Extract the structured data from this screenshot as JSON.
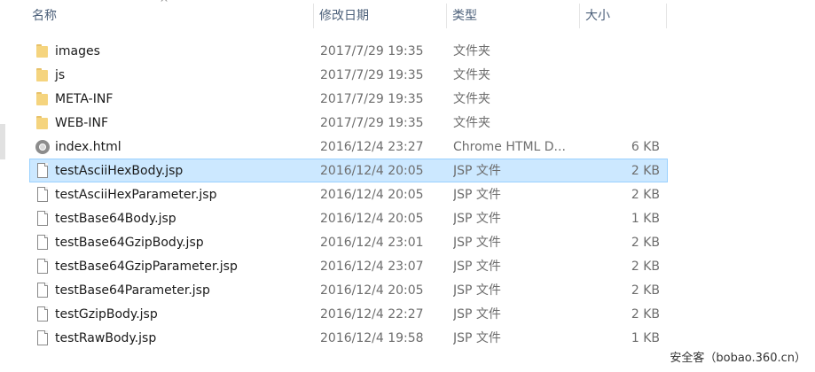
{
  "columns": {
    "name": "名称",
    "date": "修改日期",
    "type": "类型",
    "size": "大小"
  },
  "sort_indicator": "^",
  "files": [
    {
      "name": "images",
      "date": "2017/7/29 19:35",
      "type": "文件夹",
      "size": "",
      "icon": "folder-icon"
    },
    {
      "name": "js",
      "date": "2017/7/29 19:35",
      "type": "文件夹",
      "size": "",
      "icon": "folder-icon"
    },
    {
      "name": "META-INF",
      "date": "2017/7/29 19:35",
      "type": "文件夹",
      "size": "",
      "icon": "folder-icon"
    },
    {
      "name": "WEB-INF",
      "date": "2017/7/29 19:35",
      "type": "文件夹",
      "size": "",
      "icon": "folder-icon"
    },
    {
      "name": "index.html",
      "date": "2016/12/4 23:27",
      "type": "Chrome HTML D...",
      "size": "6 KB",
      "icon": "chrome-icon"
    },
    {
      "name": "testAsciiHexBody.jsp",
      "date": "2016/12/4 20:05",
      "type": "JSP 文件",
      "size": "2 KB",
      "icon": "file-icon",
      "selected": true
    },
    {
      "name": "testAsciiHexParameter.jsp",
      "date": "2016/12/4 20:05",
      "type": "JSP 文件",
      "size": "2 KB",
      "icon": "file-icon"
    },
    {
      "name": "testBase64Body.jsp",
      "date": "2016/12/4 20:05",
      "type": "JSP 文件",
      "size": "1 KB",
      "icon": "file-icon"
    },
    {
      "name": "testBase64GzipBody.jsp",
      "date": "2016/12/4 23:01",
      "type": "JSP 文件",
      "size": "2 KB",
      "icon": "file-icon"
    },
    {
      "name": "testBase64GzipParameter.jsp",
      "date": "2016/12/4 23:07",
      "type": "JSP 文件",
      "size": "2 KB",
      "icon": "file-icon"
    },
    {
      "name": "testBase64Parameter.jsp",
      "date": "2016/12/4 20:05",
      "type": "JSP 文件",
      "size": "2 KB",
      "icon": "file-icon"
    },
    {
      "name": "testGzipBody.jsp",
      "date": "2016/12/4 22:27",
      "type": "JSP 文件",
      "size": "2 KB",
      "icon": "file-icon"
    },
    {
      "name": "testRawBody.jsp",
      "date": "2016/12/4 19:58",
      "type": "JSP 文件",
      "size": "1 KB",
      "icon": "file-icon"
    }
  ],
  "watermark": "安全客（bobao.360.cn）",
  "colors": {
    "selection_bg": "#cce8ff",
    "selection_border": "#99d1ff",
    "header_text": "#4c607a",
    "folder": "#f5d47e"
  }
}
